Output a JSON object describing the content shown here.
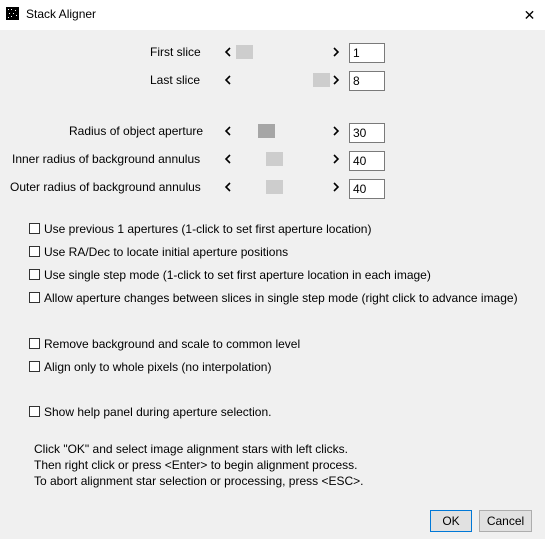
{
  "window": {
    "title": "Stack Aligner",
    "close_glyph": "✕",
    "icon": "imagej-window-icon"
  },
  "sliders": [
    {
      "label": "First slice",
      "value": "1",
      "left_glyph": "<",
      "right_glyph": ">",
      "level": 0.0
    },
    {
      "label": "Last slice",
      "value": "8",
      "left_glyph": "<",
      "right_glyph": ">",
      "level": 1.0
    },
    {
      "label": "Radius of object aperture",
      "value": "30",
      "left_glyph": "<",
      "right_glyph": ">",
      "level": 0.29
    },
    {
      "label": "Inner radius of background annulus",
      "value": "40",
      "left_glyph": "<",
      "right_glyph": ">",
      "level": 0.39
    },
    {
      "label": "Outer radius of background annulus",
      "value": "40",
      "left_glyph": "<",
      "right_glyph": ">",
      "level": 0.39
    }
  ],
  "options": [
    {
      "label": "Use previous 1 apertures (1-click to set first aperture location)",
      "checked": false
    },
    {
      "label": "Use RA/Dec to locate initial aperture positions",
      "checked": false
    },
    {
      "label": "Use single step mode (1-click to set first aperture location in each image)",
      "checked": false
    },
    {
      "label": "Allow aperture changes between slices in single step mode (right click to advance image)",
      "checked": false
    },
    {
      "label": "Remove background and scale to common level",
      "checked": false
    },
    {
      "label": "Align only to whole pixels (no interpolation)",
      "checked": false
    },
    {
      "label": "Show help panel during aperture selection.",
      "checked": false
    }
  ],
  "instructions": [
    "Click \"OK\" and select image alignment stars with left clicks.",
    "Then right click or press <Enter> to begin alignment process.",
    "To abort alignment star selection or processing, press <ESC>."
  ],
  "buttons": {
    "ok": "OK",
    "cancel": "Cancel"
  }
}
